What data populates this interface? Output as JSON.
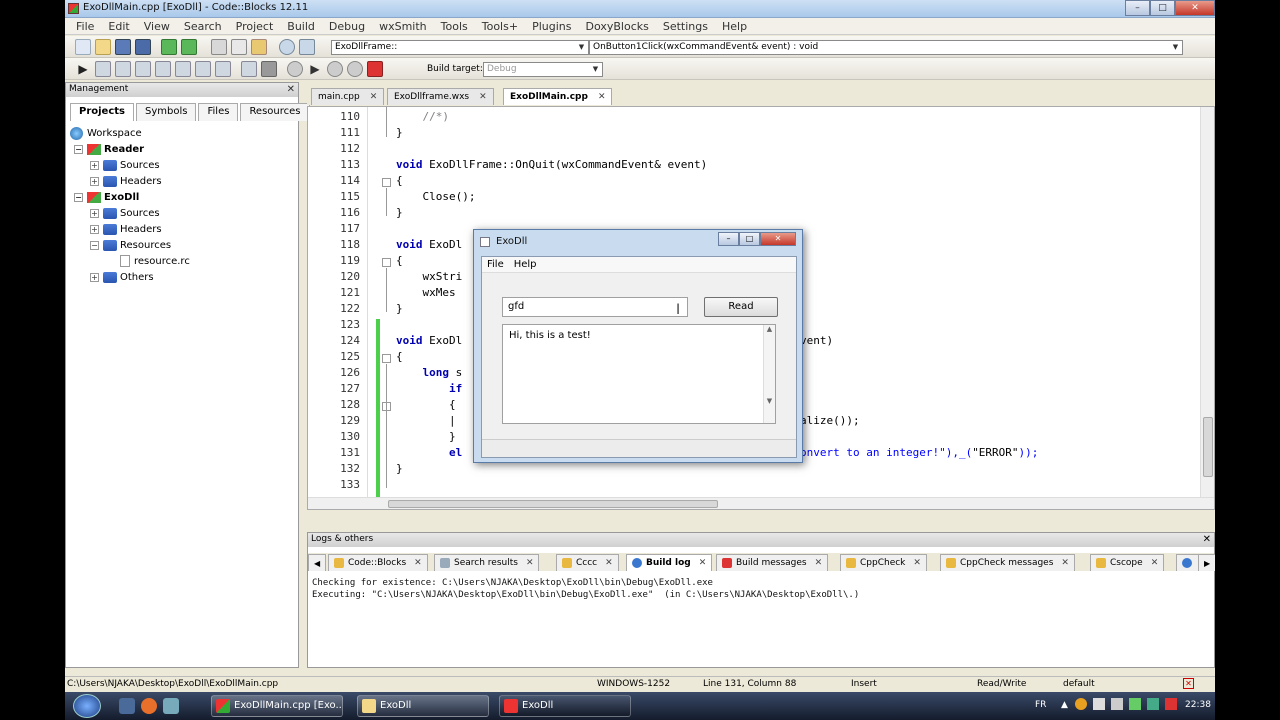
{
  "window": {
    "title": "ExoDllMain.cpp [ExoDll] - Code::Blocks 12.11"
  },
  "menu": [
    "File",
    "Edit",
    "View",
    "Search",
    "Project",
    "Build",
    "Debug",
    "wxSmith",
    "Tools",
    "Tools+",
    "Plugins",
    "DoxyBlocks",
    "Settings",
    "Help"
  ],
  "toolbar": {
    "scope_combo": "ExoDllFrame::",
    "function_combo": "OnButton1Click(wxCommandEvent& event) : void",
    "build_target_label": "Build target:",
    "build_target_value": "Debug"
  },
  "management": {
    "title": "Management",
    "tabs": [
      "Projects",
      "Symbols",
      "Files",
      "Resources"
    ],
    "tree": {
      "workspace": "Workspace",
      "reader": "Reader",
      "reader_sources": "Sources",
      "reader_headers": "Headers",
      "exodll": "ExoDll",
      "exodll_sources": "Sources",
      "exodll_headers": "Headers",
      "exodll_resources": "Resources",
      "resource_file": "resource.rc",
      "exodll_others": "Others"
    }
  },
  "editor": {
    "tabs": [
      "main.cpp",
      "ExoDllframe.wxs",
      "ExoDllMain.cpp"
    ],
    "line_numbers": [
      "110",
      "111",
      "112",
      "113",
      "114",
      "115",
      "116",
      "117",
      "118",
      "119",
      "120",
      "121",
      "122",
      "123",
      "124",
      "125",
      "126",
      "127",
      "128",
      "129",
      "130",
      "131",
      "132",
      "133"
    ],
    "code": {
      "l110": "    //*)",
      "l111": "}",
      "l113_kw": "void",
      "l113_rest": " ExoDllFrame::OnQuit(wxCommandEvent& event)",
      "l114": "{",
      "l115": "    Close();",
      "l116": "}",
      "l118_kw": "void",
      "l118_rest": " ExoDl",
      "l119": "{",
      "l120": "    wxStri",
      "l121": "    wxMes",
      "l122": "}",
      "l124_kw": "void",
      "l124_rest": " ExoDl",
      "l124_tail": "vent)",
      "l125": "{",
      "l126_kw": "    long",
      "l126_rest": " s",
      "l127": "        if",
      "l128": "        {",
      "l129": "        |",
      "l129_tail": "alize());",
      "l130": "        }",
      "l131": "        el",
      "l131_tail_a": "onvert to an integer!\"),_(",
      "l131_tail_str": "\"ERROR\"",
      "l131_tail_b": "));",
      "l132": "}"
    }
  },
  "dialog": {
    "title": "ExoDll",
    "menu": [
      "File",
      "Help"
    ],
    "input_value": "gfd",
    "read_button": "Read",
    "text_content": "Hi, this is a test!"
  },
  "logs": {
    "title": "Logs & others",
    "tabs": [
      "Code::Blocks",
      "Search results",
      "Cccc",
      "Build log",
      "Build messages",
      "CppCheck",
      "CppCheck messages",
      "Cscope"
    ],
    "lines": [
      "Checking for existence: C:\\Users\\NJAKA\\Desktop\\ExoDll\\bin\\Debug\\ExoDll.exe",
      "Executing: \"C:\\Users\\NJAKA\\Desktop\\ExoDll\\bin\\Debug\\ExoDll.exe\"  (in C:\\Users\\NJAKA\\Desktop\\ExoDll\\.)"
    ]
  },
  "status": {
    "path": "C:\\Users\\NJAKA\\Desktop\\ExoDll\\ExoDllMain.cpp",
    "encoding": "WINDOWS-1252",
    "position": "Line 131, Column 88",
    "mode": "Insert",
    "access": "Read/Write",
    "profile": "default"
  },
  "taskbar": {
    "items": [
      "ExoDllMain.cpp [Exo...",
      "ExoDll",
      "ExoDll"
    ],
    "language": "FR",
    "time": "22:38"
  },
  "colors": {
    "keyword": "#0000b0",
    "change_bar": "#4cd04c"
  }
}
